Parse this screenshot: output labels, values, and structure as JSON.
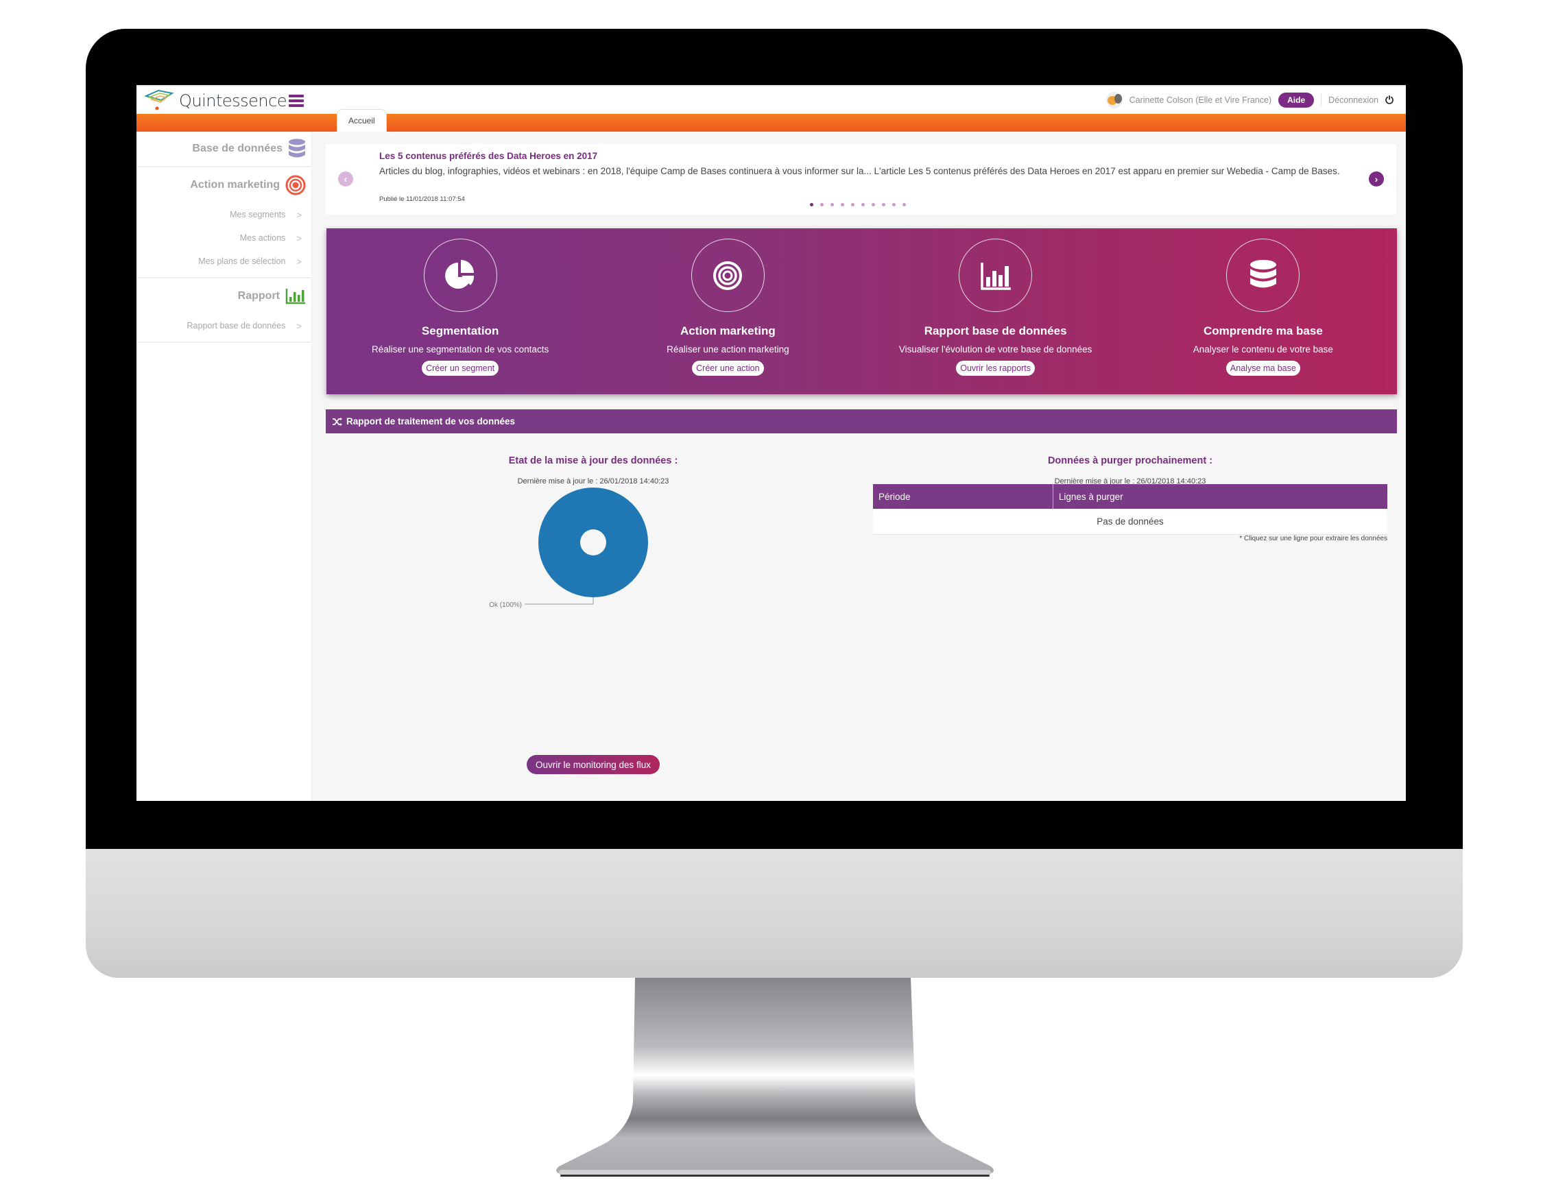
{
  "app": {
    "brand": "Quintessence",
    "user_name": "Carinette Colson (Elle et Vire France)",
    "help_label": "Aide",
    "logout_label": "Déconnexion",
    "active_tab": "Accueil",
    "colors": {
      "primary": "#7b2b83",
      "orange": "#f47e20",
      "donut": "#1f77b4",
      "gradient_start": "#7a3585",
      "gradient_end": "#b0265e"
    }
  },
  "sidebar": {
    "sections": [
      {
        "label": "Base de données",
        "icon": "database-icon",
        "items": []
      },
      {
        "label": "Action marketing",
        "icon": "target-icon",
        "items": [
          {
            "label": "Mes segments"
          },
          {
            "label": "Mes actions"
          },
          {
            "label": "Mes plans de sélection"
          }
        ]
      },
      {
        "label": "Rapport",
        "icon": "bar-chart-icon",
        "items": [
          {
            "label": "Rapport base de données"
          }
        ]
      }
    ]
  },
  "news": {
    "title": "Les 5 contenus préférés des Data Heroes en 2017",
    "body": "Articles du blog, infographies, vidéos et webinars : en 2018, l'équipe Camp de Bases continuera à vous informer sur la... L'article Les 5 contenus préférés des Data Heroes en 2017 est apparu en premier sur Webedia - Camp de Bases.",
    "date": "Publié le 11/01/2018 11:07:54",
    "slide_count": 10,
    "active_slide": 1
  },
  "banner": {
    "cards": [
      {
        "icon": "pie-chart-icon",
        "title": "Segmentation",
        "desc": "Réaliser une segmentation de vos contacts",
        "button": "Créer un segment"
      },
      {
        "icon": "target-icon",
        "title": "Action marketing",
        "desc": "Réaliser une action marketing",
        "button": "Créer une action"
      },
      {
        "icon": "bar-chart-icon",
        "title": "Rapport base de données",
        "desc": "Visualiser l'évolution de votre base de données",
        "button": "Ouvrir les rapports"
      },
      {
        "icon": "database-icon",
        "title": "Comprendre ma base",
        "desc": "Analyser le contenu de votre base",
        "button": "Analyse ma base"
      }
    ]
  },
  "report": {
    "header": "Rapport de traitement de vos données",
    "update_state": {
      "title": "Etat de la mise à jour des données :",
      "last_update": "Dernière mise à jour le : 26/01/2018 14:40:23",
      "button": "Ouvrir le monitoring des flux"
    },
    "purge": {
      "title": "Données à purger prochainement :",
      "last_update": "Dernière mise à jour le : 26/01/2018 14:40:23",
      "columns": [
        "Période",
        "Lignes à purger"
      ],
      "empty": "Pas de données",
      "note": "* Cliquez sur une ligne pour extraire les données"
    }
  },
  "chart_data": {
    "type": "pie",
    "variant": "donut",
    "title": "Etat de la mise à jour des données :",
    "slices": [
      {
        "label": "Ok",
        "value": 100,
        "display": "Ok (100%)",
        "color": "#1f77b4"
      }
    ]
  }
}
